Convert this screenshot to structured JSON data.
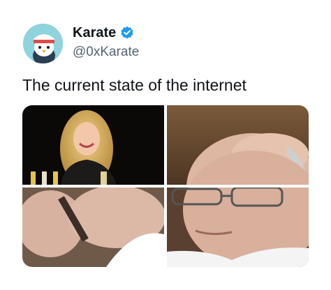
{
  "tweet": {
    "display_name": "Karate",
    "handle": "@0xKarate",
    "verified": true,
    "text": "The current state of the internet"
  },
  "media": {
    "layout": "2x2-grid",
    "panels": [
      {
        "position": "top-left",
        "subject": "smiling-woman-photo"
      },
      {
        "position": "top-right",
        "subject": "man-face-top-photo"
      },
      {
        "position": "bottom-left",
        "subject": "hands-holding-pen-photo"
      },
      {
        "position": "bottom-right",
        "subject": "man-face-bottom-photo"
      }
    ]
  },
  "colors": {
    "name": "#0f1419",
    "handle": "#536471",
    "verified_badge": "#1d9bf0",
    "avatar_bg": "#8fd3dd"
  },
  "icons": {
    "verified": "verified-badge-icon",
    "avatar": "penguin-avatar"
  }
}
